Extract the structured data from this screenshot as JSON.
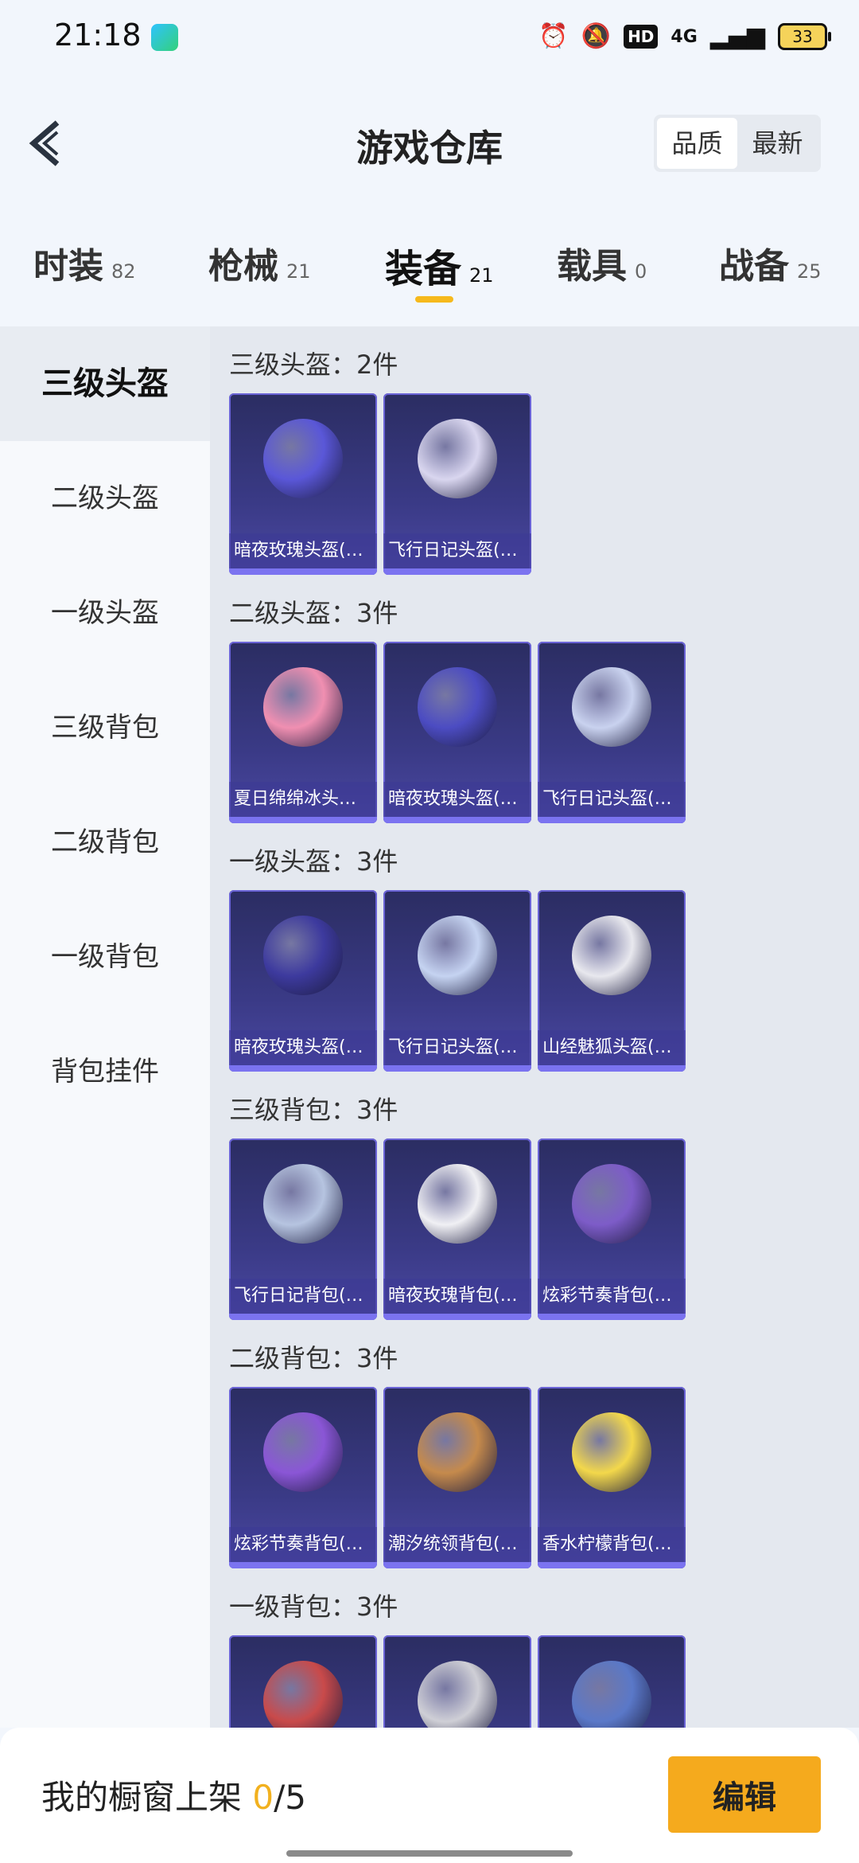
{
  "status": {
    "time": "21:18",
    "hd": "HD",
    "net": "4G",
    "battery": "33"
  },
  "header": {
    "title": "游戏仓库",
    "sort_options": [
      "品质",
      "最新"
    ]
  },
  "tabs": [
    {
      "label": "时装",
      "count": "82"
    },
    {
      "label": "枪械",
      "count": "21"
    },
    {
      "label": "装备",
      "count": "21"
    },
    {
      "label": "载具",
      "count": "0"
    },
    {
      "label": "战备",
      "count": "25"
    }
  ],
  "sidebar": {
    "items": [
      {
        "label": "三级头盔"
      },
      {
        "label": "二级头盔"
      },
      {
        "label": "一级头盔"
      },
      {
        "label": "三级背包"
      },
      {
        "label": "二级背包"
      },
      {
        "label": "一级背包"
      },
      {
        "label": "背包挂件"
      }
    ]
  },
  "sections": [
    {
      "title": "三级头盔：2件",
      "items": [
        {
          "name": "暗夜玫瑰头盔(…",
          "color": "#5a57d8"
        },
        {
          "name": "飞行日记头盔(…",
          "color": "#d9d6ef"
        }
      ]
    },
    {
      "title": "二级头盔：3件",
      "items": [
        {
          "name": "夏日绵绵冰头…",
          "color": "#f08fb1"
        },
        {
          "name": "暗夜玫瑰头盔(…",
          "color": "#4c4cc2"
        },
        {
          "name": "飞行日记头盔(…",
          "color": "#c9d2ef"
        }
      ]
    },
    {
      "title": "一级头盔：3件",
      "items": [
        {
          "name": "暗夜玫瑰头盔(…",
          "color": "#3d3a9e"
        },
        {
          "name": "飞行日记头盔(…",
          "color": "#c5d3f1"
        },
        {
          "name": "山经魅狐头盔(…",
          "color": "#e8e8ee"
        }
      ]
    },
    {
      "title": "三级背包：3件",
      "items": [
        {
          "name": "飞行日记背包(…",
          "color": "#b6c4e0"
        },
        {
          "name": "暗夜玫瑰背包(…",
          "color": "#f0f0f4"
        },
        {
          "name": "炫彩节奏背包(…",
          "color": "#7d5cc8"
        }
      ]
    },
    {
      "title": "二级背包：3件",
      "items": [
        {
          "name": "炫彩节奏背包(…",
          "color": "#8a56d6"
        },
        {
          "name": "潮汐统领背包(…",
          "color": "#c58a4c"
        },
        {
          "name": "香水柠檬背包(…",
          "color": "#f3d84b"
        }
      ]
    },
    {
      "title": "一级背包：3件",
      "items": [
        {
          "name": "",
          "color": "#c94a4a"
        },
        {
          "name": "",
          "color": "#cfcfd6"
        },
        {
          "name": "",
          "color": "#5a78c8"
        }
      ]
    }
  ],
  "bottom": {
    "label": "我的橱窗上架",
    "current": "0",
    "separator": "/",
    "max": "5",
    "edit_label": "编辑"
  }
}
